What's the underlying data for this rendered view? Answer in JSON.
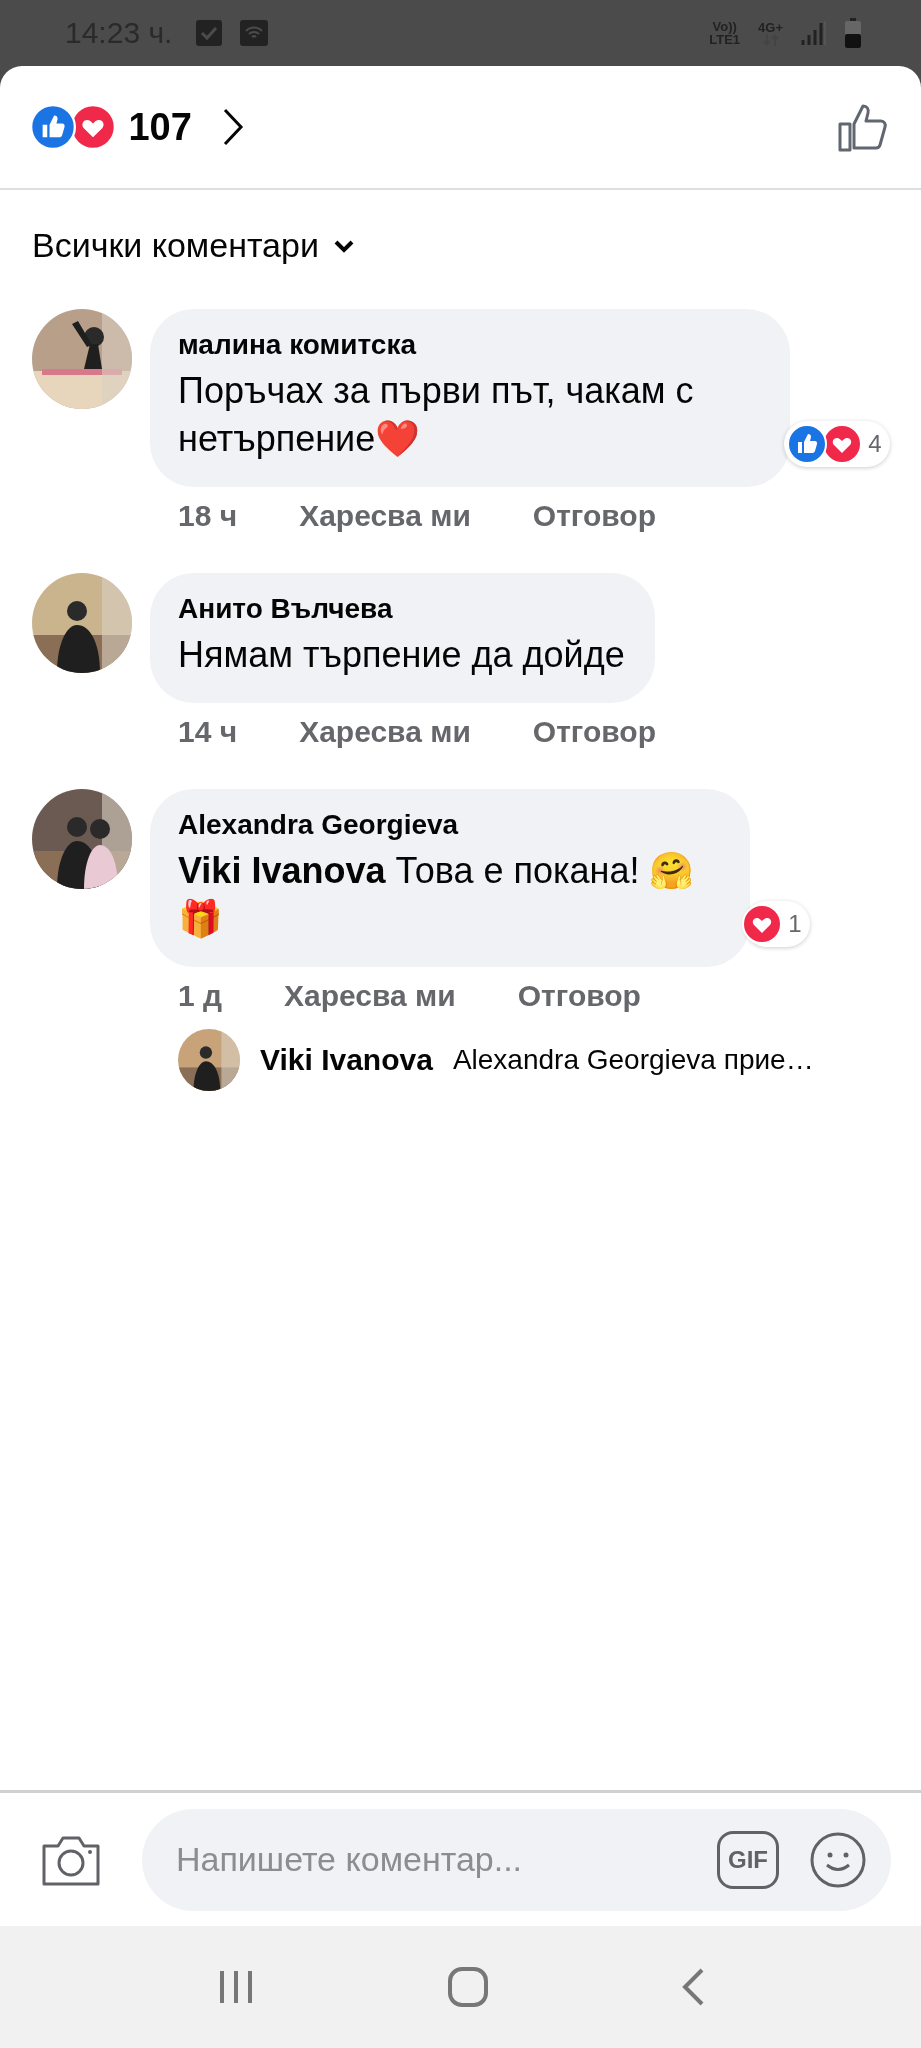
{
  "status_bar": {
    "time": "14:23 ч.",
    "network_top": "Vo))",
    "network_bottom": "LTE1",
    "network_type": "4G+"
  },
  "header": {
    "reactions": [
      {
        "kind": "like"
      },
      {
        "kind": "love"
      }
    ],
    "count": "107"
  },
  "filter": {
    "label": "Всички коментари"
  },
  "comments": [
    {
      "author": "малина комитска",
      "text": "Поръчах за първи път, чакам с нетърпение❤️",
      "time": "18 ч",
      "like": "Харесва ми",
      "reply": "Отговор",
      "reactions": [
        {
          "kind": "like"
        },
        {
          "kind": "love"
        }
      ],
      "reaction_count": "4"
    },
    {
      "author": "Анито Вълчева",
      "text": "Нямам търпение да дойде",
      "time": "14 ч",
      "like": "Харесва ми",
      "reply": "Отговор"
    },
    {
      "author": "Alexandra Georgieva",
      "text": "**Viki Ivanova** Това е покана! 🤗 🎁",
      "time": "1 д",
      "like": "Харесва ми",
      "reply": "Отговор",
      "reactions": [
        {
          "kind": "love"
        }
      ],
      "reaction_count": "1",
      "replies": [
        {
          "author": "Viki Ivanova",
          "text": "Alexandra Georgieva прие…"
        }
      ]
    }
  ],
  "composer": {
    "placeholder": "Напишете коментар...",
    "gif": "GIF"
  }
}
